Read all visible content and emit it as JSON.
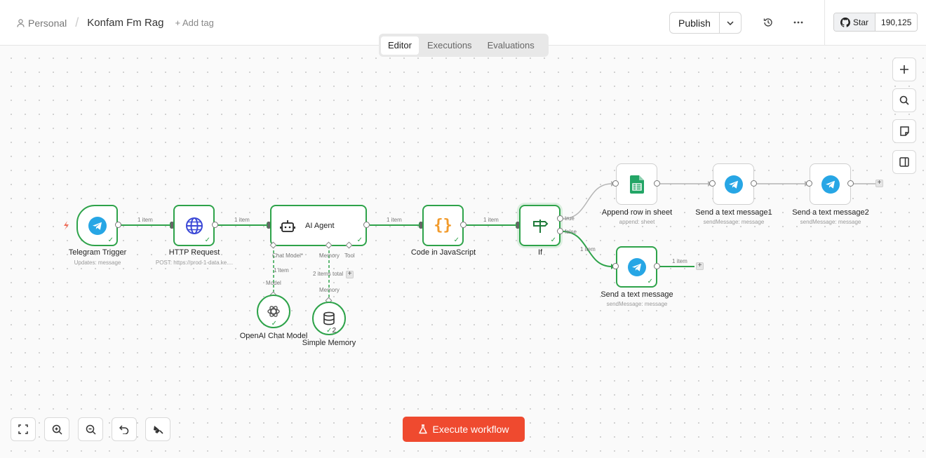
{
  "header": {
    "breadcrumb_project": "Personal",
    "workflow_title": "Konfam Fm Rag",
    "add_tag_label": "+ Add tag",
    "publish_label": "Publish",
    "github_star_label": "Star",
    "github_star_count": "190,125"
  },
  "tabs": [
    {
      "label": "Editor",
      "active": true
    },
    {
      "label": "Executions",
      "active": false
    },
    {
      "label": "Evaluations",
      "active": false
    }
  ],
  "nodes": {
    "telegram_trigger": {
      "label": "Telegram Trigger",
      "subtitle": "Updates: message",
      "icon": "telegram-icon"
    },
    "http_request": {
      "label": "HTTP Request",
      "subtitle": "POST: https://prod-1-data.ke....",
      "icon": "globe-icon"
    },
    "ai_agent": {
      "label": "AI Agent",
      "icon": "robot-icon"
    },
    "code_js": {
      "label": "Code in JavaScript",
      "icon": "braces-icon"
    },
    "if_node": {
      "label": "If",
      "icon": "signpost-icon"
    },
    "append_sheet": {
      "label": "Append row in sheet",
      "subtitle": "append: sheet",
      "icon": "google-sheets-icon"
    },
    "send_msg1": {
      "label": "Send a text message1",
      "subtitle": "sendMessage: message",
      "icon": "telegram-icon"
    },
    "send_msg2": {
      "label": "Send a text message2",
      "subtitle": "sendMessage: message",
      "icon": "telegram-icon"
    },
    "send_msg": {
      "label": "Send a text message",
      "subtitle": "sendMessage: message",
      "icon": "telegram-icon"
    },
    "openai_model": {
      "label": "OpenAI Chat Model",
      "icon": "openai-icon"
    },
    "simple_memory": {
      "label": "Simple Memory",
      "icon": "database-icon",
      "run_count": "2"
    }
  },
  "agent_ports": {
    "chat_model": "Chat Model*",
    "memory": "Memory",
    "tool": "Tool"
  },
  "edge_labels": {
    "trigger_http": "1 item",
    "http_agent": "1 item",
    "agent_code": "1 item",
    "code_if": "1 item",
    "if_true": "true",
    "if_false": "false",
    "false_send": "1 item",
    "send_out": "1 item",
    "model_items": "1 item",
    "model_port": "Model",
    "memory_items": "2 items total",
    "memory_port": "Memory"
  },
  "controls": {
    "execute_label": "Execute workflow"
  },
  "colors": {
    "success": "#2ea34a",
    "accent": "#ef4a2f",
    "telegram": "#27a6e5"
  }
}
